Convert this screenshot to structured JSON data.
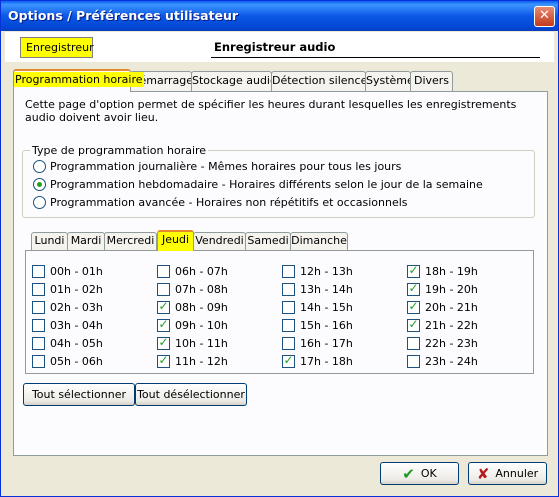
{
  "window": {
    "title": "Options / Préférences utilisateur",
    "close_glyph": "✕"
  },
  "header": {
    "section_tag": "Enregistreur",
    "section_title": "Enregistreur audio"
  },
  "tabs": [
    {
      "label": "Programmation horaire",
      "active": true
    },
    {
      "label": "Démarrage",
      "active": false
    },
    {
      "label": "Stockage audio",
      "active": false
    },
    {
      "label": "Détection silences",
      "active": false
    },
    {
      "label": "Système",
      "active": false
    },
    {
      "label": "Divers",
      "active": false
    }
  ],
  "intro_text": "Cette page d'option permet de spécifier les heures durant lesquelles les enregistrements audio doivent avoir lieu.",
  "schedule_type": {
    "legend": "Type de programmation horaire",
    "options": [
      {
        "label": "Programmation journalière - Mêmes horaires pour tous les jours",
        "selected": false
      },
      {
        "label": "Programmation hebdomadaire - Horaires différents selon le jour de la semaine",
        "selected": true
      },
      {
        "label": "Programmation avancée - Horaires non répétitifs et occasionnels",
        "selected": false
      }
    ]
  },
  "days": [
    {
      "label": "Lundi",
      "active": false
    },
    {
      "label": "Mardi",
      "active": false
    },
    {
      "label": "Mercredi",
      "active": false
    },
    {
      "label": "Jeudi",
      "active": true
    },
    {
      "label": "Vendredi",
      "active": false
    },
    {
      "label": "Samedi",
      "active": false
    },
    {
      "label": "Dimanche",
      "active": false
    }
  ],
  "slots": [
    {
      "label": "00h - 01h",
      "checked": false
    },
    {
      "label": "01h - 02h",
      "checked": false
    },
    {
      "label": "02h - 03h",
      "checked": false
    },
    {
      "label": "03h - 04h",
      "checked": false
    },
    {
      "label": "04h - 05h",
      "checked": false
    },
    {
      "label": "05h - 06h",
      "checked": false
    },
    {
      "label": "06h - 07h",
      "checked": false
    },
    {
      "label": "07h - 08h",
      "checked": false
    },
    {
      "label": "08h - 09h",
      "checked": true
    },
    {
      "label": "09h - 10h",
      "checked": true
    },
    {
      "label": "10h - 11h",
      "checked": true
    },
    {
      "label": "11h - 12h",
      "checked": true
    },
    {
      "label": "12h - 13h",
      "checked": false
    },
    {
      "label": "13h - 14h",
      "checked": false
    },
    {
      "label": "14h - 15h",
      "checked": false
    },
    {
      "label": "15h - 16h",
      "checked": false
    },
    {
      "label": "16h - 17h",
      "checked": false
    },
    {
      "label": "17h - 18h",
      "checked": true
    },
    {
      "label": "18h - 19h",
      "checked": true
    },
    {
      "label": "19h - 20h",
      "checked": true
    },
    {
      "label": "20h - 21h",
      "checked": true
    },
    {
      "label": "21h - 22h",
      "checked": true
    },
    {
      "label": "22h - 23h",
      "checked": false
    },
    {
      "label": "23h - 24h",
      "checked": false
    }
  ],
  "buttons": {
    "select_all": "Tout sélectionner",
    "deselect_all": "Tout désélectionner",
    "ok": "OK",
    "cancel": "Annuler",
    "ok_icon": "check-icon",
    "cancel_icon": "x-icon"
  },
  "colors": {
    "highlight": "#ffff00",
    "check": "#21a121",
    "titlebar": "#0a5cf3"
  }
}
